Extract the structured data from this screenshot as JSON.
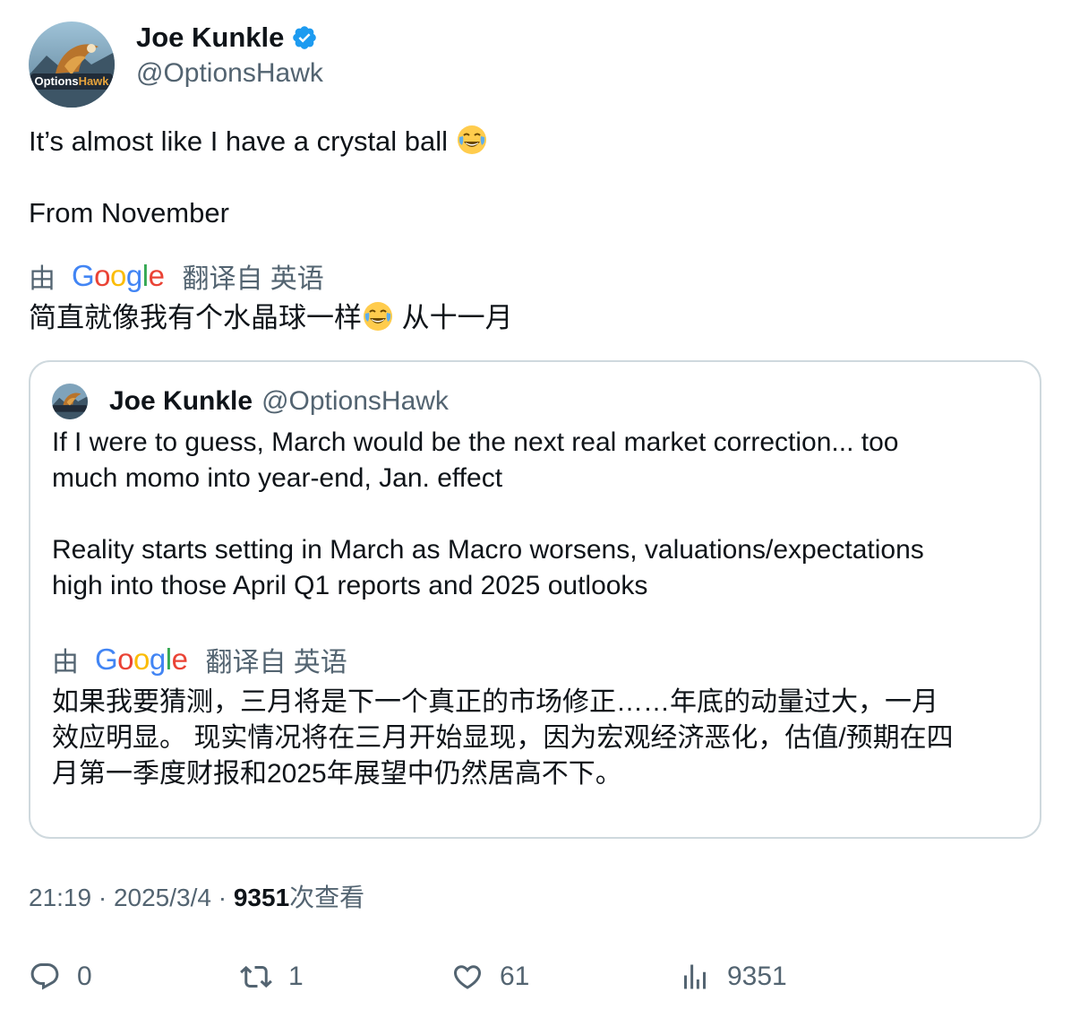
{
  "author": {
    "display_name": "Joe Kunkle",
    "handle": "@OptionsHawk",
    "avatar_text": "OptionsHawk"
  },
  "tweet": {
    "line1": "It’s almost like I have a crystal ball",
    "line1_emoji": "laughing-tears",
    "line2": "From November"
  },
  "translation_banner": {
    "by": "由",
    "google": [
      "G",
      "o",
      "o",
      "g",
      "l",
      "e"
    ],
    "from_language": "翻译自 英语"
  },
  "translation": {
    "part1": "简直就像我有个水晶球一样",
    "part2": " 从十一月"
  },
  "quoted": {
    "display_name": "Joe Kunkle",
    "handle": "@OptionsHawk",
    "lines": [
      "If I were to guess, March would be the next real market correction... too",
      "much momo into year-end, Jan. effect",
      "",
      "Reality starts setting in March as Macro worsens, valuations/expectations",
      "high into those April Q1 reports and 2025 outlooks"
    ],
    "translation_banner": {
      "by": "由",
      "from_language": "翻译自 英语"
    },
    "translation_lines": [
      "如果我要猜测，三月将是下一个真正的市场修正……年底的动量过大，一月",
      "效应明显。 现实情况将在三月开始显现，因为宏观经济恶化，估值/预期在四",
      "月第一季度财报和2025年展望中仍然居高不下。"
    ]
  },
  "meta": {
    "time": "21:19",
    "date": "2025/3/4",
    "separator": " · ",
    "views_count": "9351",
    "views_label": "次查看"
  },
  "actions": {
    "replies": "0",
    "retweets": "1",
    "likes": "61",
    "views": "9351"
  },
  "colors": {
    "text": "#0f1419",
    "secondary": "#536471",
    "border": "#cfd9de",
    "verified": "#1d9bf0"
  }
}
